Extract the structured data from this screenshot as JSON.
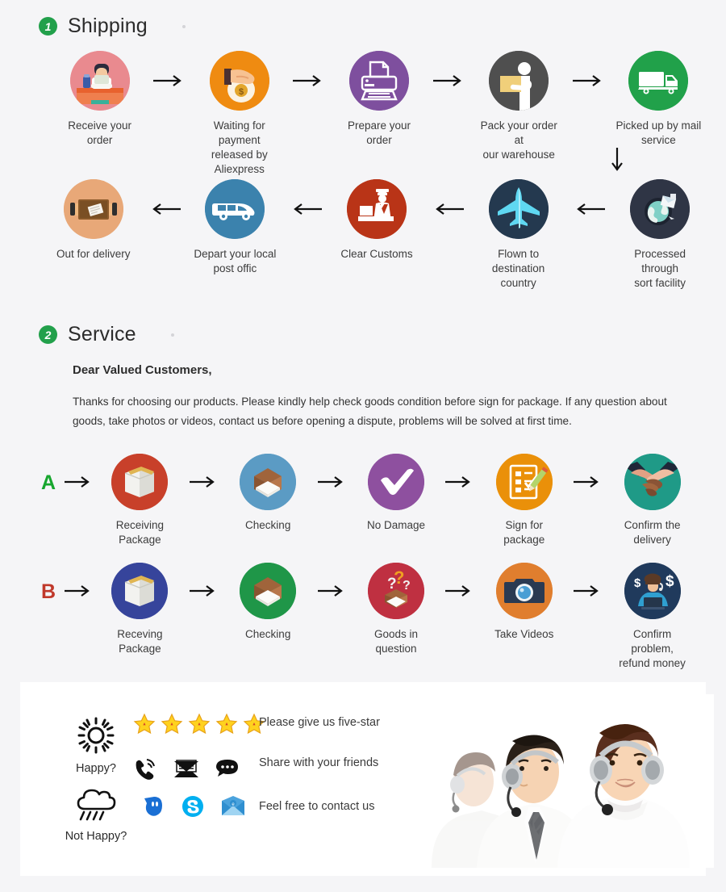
{
  "theme": {
    "page_bg": "#f5f5f7",
    "panel_bg": "#ffffff",
    "badge_green": "#22a04b",
    "letter_a_color": "#17a62e",
    "letter_b_color": "#c0392b"
  },
  "shipping": {
    "badge": "1",
    "title": "Shipping",
    "row1": [
      {
        "label": "Receive your order",
        "icon": "person-laptop-icon",
        "circle_color": "#e98a8f"
      },
      {
        "label": "Waiting for payment\nreleased by Aliexpress",
        "icon": "hand-money-bag-icon",
        "circle_color": "#ef8b11"
      },
      {
        "label": "Prepare your order",
        "icon": "printer-icon",
        "circle_color": "#7e4f9e"
      },
      {
        "label": "Pack your order at\nour warehouse",
        "icon": "worker-packing-icon",
        "circle_color": "#4f4f4f"
      },
      {
        "label": "Picked up by mail service",
        "icon": "delivery-truck-icon",
        "circle_color": "#21a14a"
      }
    ],
    "row2": [
      {
        "label": "Out for delivery",
        "icon": "mailbox-parcel-icon",
        "circle_color": "#e8a878"
      },
      {
        "label": "Depart your local\npost offic",
        "icon": "delivery-van-icon",
        "circle_color": "#3b82ad"
      },
      {
        "label": "Clear  Customs",
        "icon": "customs-officer-icon",
        "circle_color": "#b93417"
      },
      {
        "label": "Flown to\ndestination country",
        "icon": "airplane-icon",
        "circle_color": "#24394f"
      },
      {
        "label": "Processed through\nsort facility",
        "icon": "global-sorting-icon",
        "circle_color": "#2f3545"
      }
    ],
    "arrow_right": "→",
    "arrow_left": "←",
    "arrow_down": "↓"
  },
  "service": {
    "badge": "2",
    "title": "Service",
    "greeting": "Dear Valued Customers,",
    "paragraph": "Thanks for choosing our products. Please kindly help check goods condition before sign for package. If any question about goods, take photos or videos, contact us before opening a dispute, problems will be solved at first time.",
    "row_a": {
      "letter": "A",
      "steps": [
        {
          "label": "Receiving Package",
          "icon": "sealed-box-icon",
          "circle_color": "#c8402a"
        },
        {
          "label": "Checking",
          "icon": "open-box-icon",
          "circle_color": "#5b9bc4"
        },
        {
          "label": "No Damage",
          "icon": "checkmark-icon",
          "circle_color": "#8e509f"
        },
        {
          "label": "Sign for package",
          "icon": "signed-document-icon",
          "circle_color": "#ea9009"
        },
        {
          "label": "Confirm the delivery",
          "icon": "handshake-icon",
          "circle_color": "#1f9a87"
        }
      ]
    },
    "row_b": {
      "letter": "B",
      "steps": [
        {
          "label": "Receving Package",
          "icon": "sealed-box-icon",
          "circle_color": "#36449b"
        },
        {
          "label": "Checking",
          "icon": "open-box-icon",
          "circle_color": "#1f9648"
        },
        {
          "label": "Goods in question",
          "icon": "question-box-icon",
          "circle_color": "#bf3041"
        },
        {
          "label": "Take Videos",
          "icon": "camera-icon",
          "circle_color": "#e07e2e"
        },
        {
          "label": "Confirm problem,\nrefund money",
          "icon": "support-agent-money-icon",
          "circle_color": "#203a5c"
        }
      ]
    }
  },
  "feedback": {
    "happy": {
      "mood_icon": "sun-icon",
      "mood_label": "Happy?",
      "stars": 5,
      "star_icon": "star-icon",
      "line1_text": "Please give us five-star",
      "line2_text": "Share with your friends",
      "line2_icons": [
        "phone-ringing-icon",
        "envelope-icon",
        "chat-bubble-icon"
      ]
    },
    "not_happy": {
      "mood_icon": "rain-cloud-icon",
      "mood_label": "Not Happy?",
      "text": "Feel free to contact us",
      "icons": [
        "qq-icon",
        "skype-icon",
        "email-icon"
      ]
    },
    "photo_alt": "customer-service-team-photo"
  }
}
